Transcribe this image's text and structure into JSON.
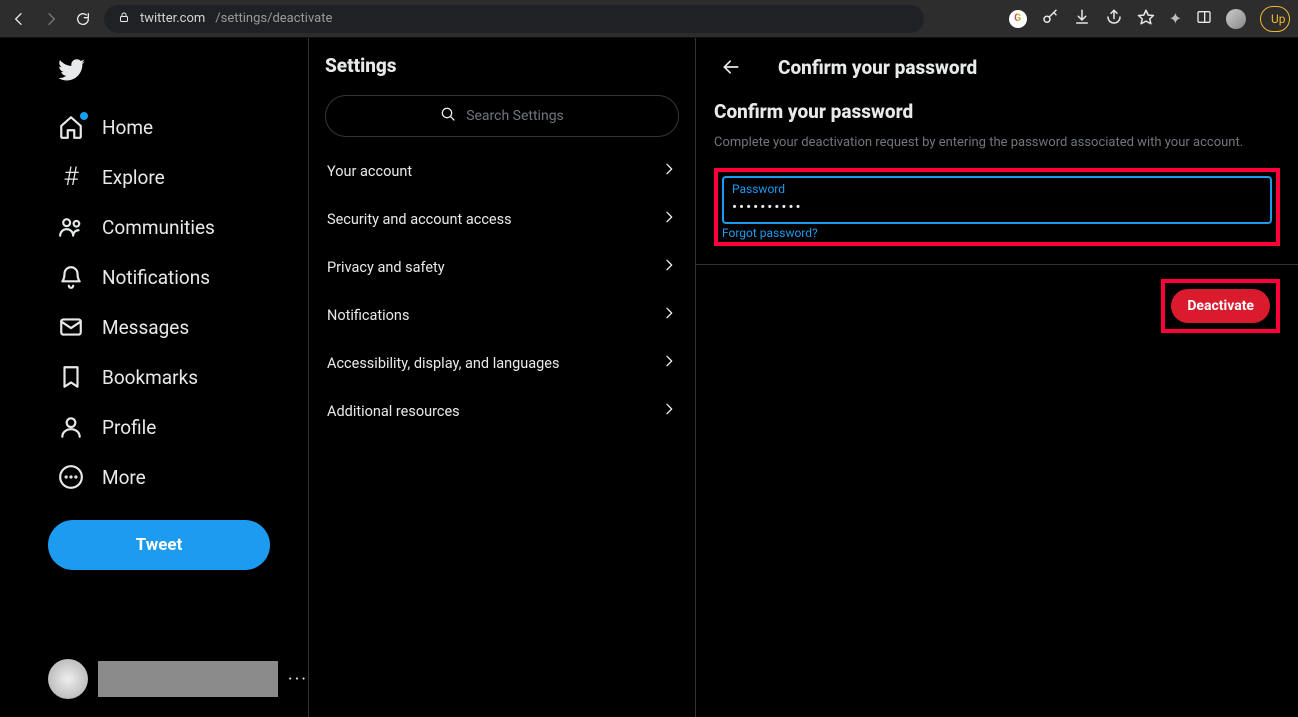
{
  "browser": {
    "url_host": "twitter.com",
    "url_path": "/settings/deactivate",
    "upgrade": "Up"
  },
  "nav": {
    "home": "Home",
    "explore": "Explore",
    "communities": "Communities",
    "notifications": "Notifications",
    "messages": "Messages",
    "bookmarks": "Bookmarks",
    "profile": "Profile",
    "more": "More",
    "tweet": "Tweet"
  },
  "settings": {
    "title": "Settings",
    "search_placeholder": "Search Settings",
    "items": [
      "Your account",
      "Security and account access",
      "Privacy and safety",
      "Notifications",
      "Accessibility, display, and languages",
      "Additional resources"
    ]
  },
  "panel": {
    "header": "Confirm your password",
    "subtitle": "Confirm your password",
    "description": "Complete your deactivation request by entering the password associated with your account.",
    "password_label": "Password",
    "password_value": "••••••••••",
    "forgot": "Forgot password?",
    "deactivate": "Deactivate"
  }
}
